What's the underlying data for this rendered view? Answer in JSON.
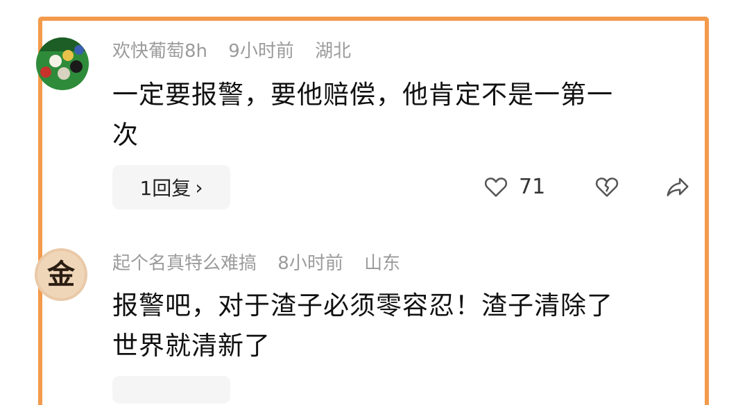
{
  "comments": [
    {
      "author": "欢快葡萄8h",
      "time": "9小时前",
      "location": "湖北",
      "text_line1": "一定要报警，要他赔偿，他肯定不是一第一",
      "text_line2": "次",
      "reply_label": "1回复",
      "likes": "71",
      "avatar_icon": "billiard-balls-avatar"
    },
    {
      "author": "起个名真特么难搞",
      "time": "8小时前",
      "location": "山东",
      "text_line1": "报警吧，对于渣子必须零容忍！渣子清除了",
      "text_line2": "世界就清新了",
      "avatar_icon": "jin-character-avatar",
      "avatar_char": "金"
    }
  ],
  "colors": {
    "frame": "#f39a4c",
    "meta_text": "#9b9b9b",
    "body_text": "#111111",
    "reply_bg": "#f5f5f5"
  },
  "icons": {
    "chevron": "›",
    "like": "heart-outline-icon",
    "dislike": "broken-heart-icon",
    "share": "share-arrow-icon"
  }
}
